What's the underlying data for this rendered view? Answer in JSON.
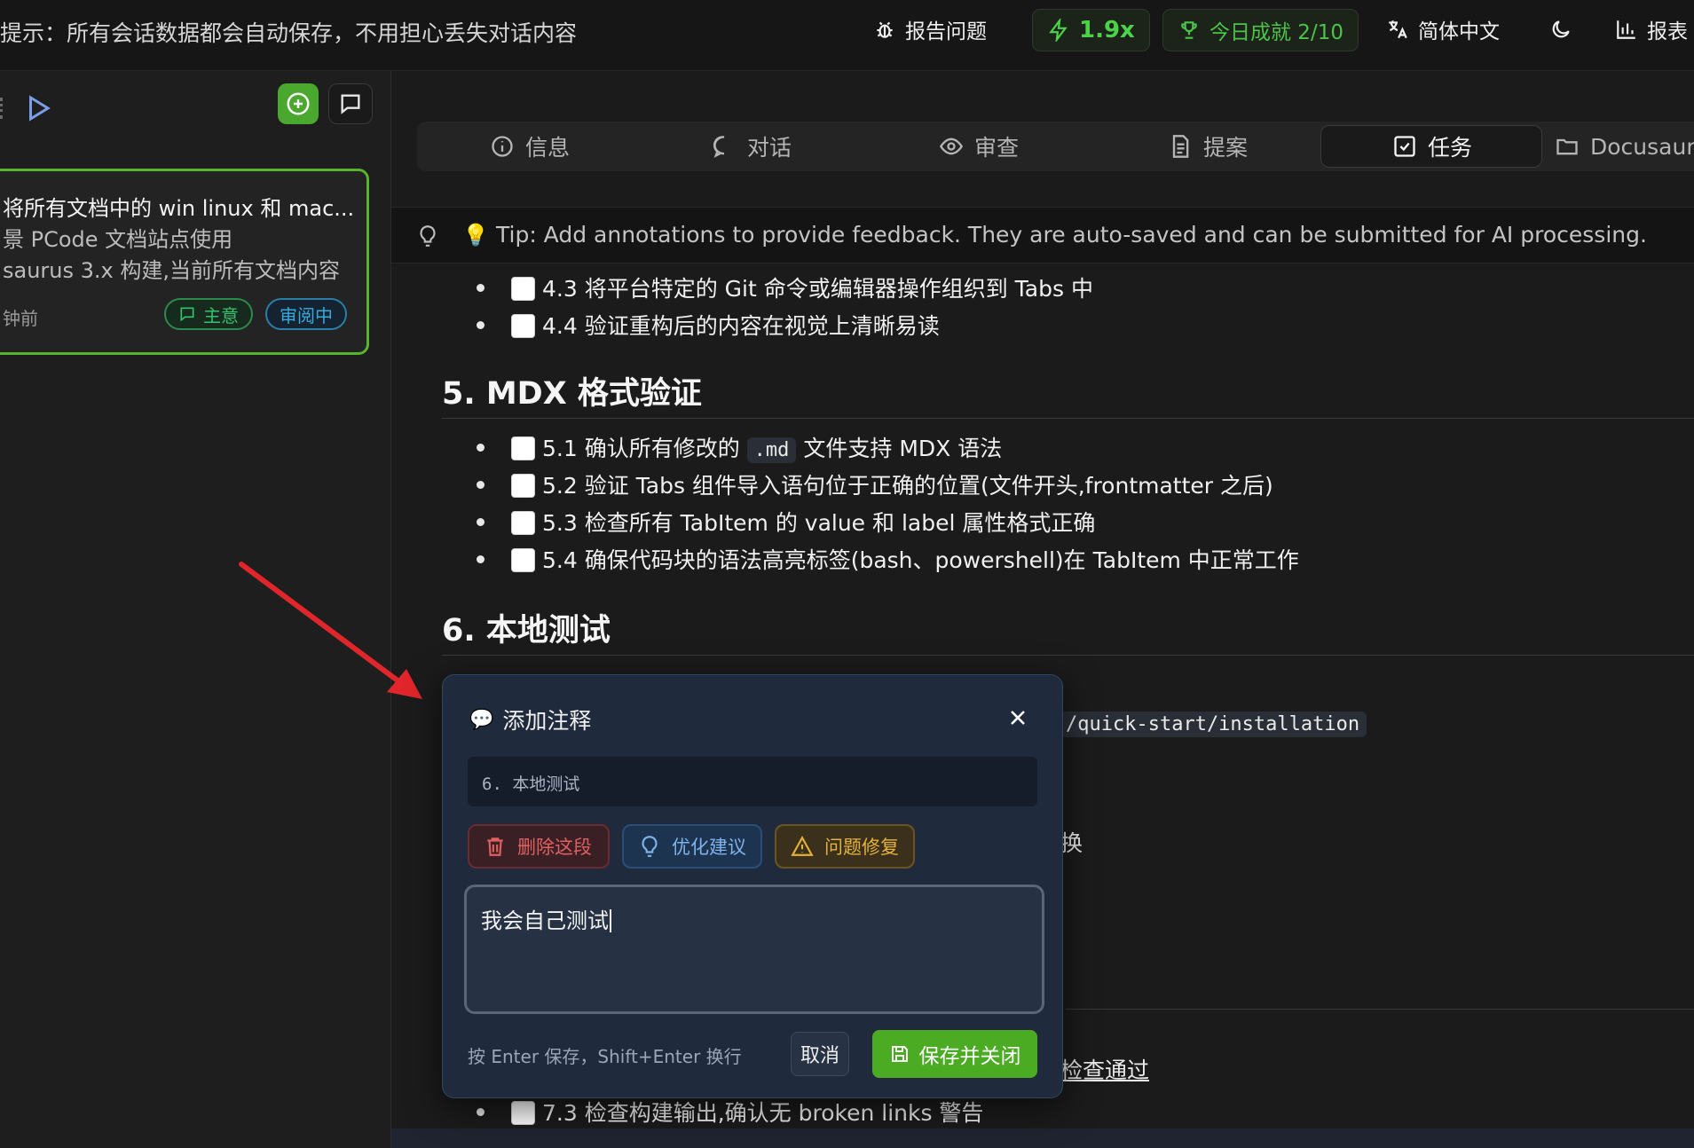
{
  "topbar": {
    "notice": "提示：所有会话数据都会自动保存，不用担心丢失对话内容",
    "report_label": "报告问题",
    "speed": "1.9x",
    "achievement": "今日成就 2/10",
    "language": "简体中文",
    "reports_label": "报表",
    "icons": [
      "bug-icon",
      "bolt-icon",
      "trophy-icon",
      "translate-icon",
      "moon-icon",
      "bar-chart-icon"
    ]
  },
  "sidebar": {
    "card": {
      "title": "将所有文档中的 win linux 和 mac...",
      "desc_line1": "景 PCode 文档站点使用",
      "desc_line2": "saurus 3.x 构建,当前所有文档内容...",
      "time": "钟前",
      "badge_idea": "主意",
      "badge_review": "审阅中"
    }
  },
  "tabs": [
    {
      "label": "信息",
      "icon": "info-icon"
    },
    {
      "label": "对话",
      "icon": "chat-icon"
    },
    {
      "label": "审查",
      "icon": "eye-icon"
    },
    {
      "label": "提案",
      "icon": "document-icon"
    },
    {
      "label": "任务",
      "icon": "checkbox-icon",
      "active": true
    },
    {
      "label": "Docusaur",
      "icon": "folder-icon"
    }
  ],
  "tip": {
    "text": "Tip: Add annotations to provide feedback. They are auto-saved and can be submitted for AI processing."
  },
  "tasks": {
    "item_4_3": "4.3 将平台特定的 Git 命令或编辑器操作组织到 Tabs 中",
    "item_4_4": "4.4 验证重构后的内容在视觉上清晰易读",
    "section5_title": "5. MDX 格式验证",
    "item_5_1_pre": "5.1 确认所有修改的",
    "item_5_1_code": ".md",
    "item_5_1_post": "文件支持 MDX 语法",
    "item_5_2": "5.2 验证 Tabs 组件导入语句位于正确的位置(文件开头,frontmatter 之后)",
    "item_5_3": "5.3 检查所有 TabItem 的 value 和 label 属性格式正确",
    "item_5_4": "5.4 确保代码块的语法高亮标签(bash、powershell)在 TabItem 中正常工作",
    "section6_title": "6. 本地测试",
    "peek_code": "/quick-start/installation",
    "peek_char": "换",
    "peek_pass": "检查通过",
    "item_7_3": "7.3 检查构建输出,确认无 broken links 警告"
  },
  "annotation_modal": {
    "title": "添加注释",
    "quote": "6. 本地测试",
    "chip_delete": "删除这段",
    "chip_optimize": "优化建议",
    "chip_fix": "问题修复",
    "text": "我会自己测试",
    "hint": "按 Enter 保存，Shift+Enter 换行",
    "cancel": "取消",
    "save": "保存并关闭"
  },
  "colors": {
    "accent_green": "#4bac24",
    "card_border": "#56b52f",
    "annotation_arrow": "#e0262b"
  }
}
